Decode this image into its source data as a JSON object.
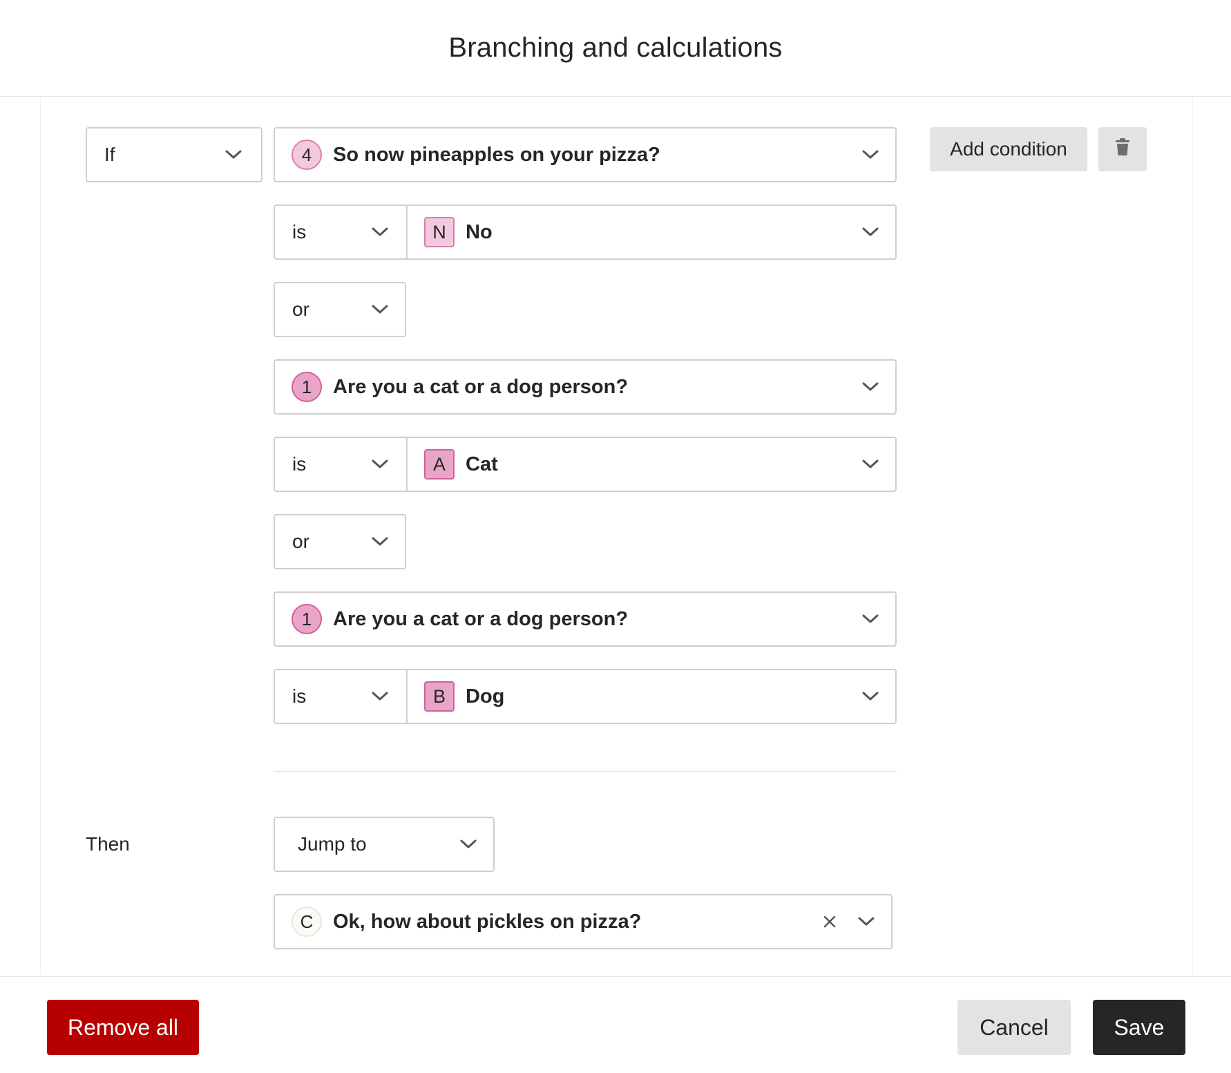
{
  "dialog": {
    "title": "Branching and calculations"
  },
  "logic": {
    "if_label": "If",
    "add_condition": "Add condition",
    "conditions": [
      {
        "question_badge": "4",
        "question": "So now pineapples on your pizza?",
        "operator": "is",
        "answer_badge": "N",
        "answer": "No",
        "joiner": "or"
      },
      {
        "question_badge": "1",
        "question": "Are you a cat or a dog person?",
        "operator": "is",
        "answer_badge": "A",
        "answer": "Cat",
        "joiner": "or"
      },
      {
        "question_badge": "1",
        "question": "Are you a cat or a dog person?",
        "operator": "is",
        "answer_badge": "B",
        "answer": "Dog"
      }
    ],
    "then_label": "Then",
    "action": "Jump to",
    "destination": {
      "badge": "C",
      "label": "Ok, how about pickles on pizza?"
    }
  },
  "footer": {
    "remove_all": "Remove all",
    "cancel": "Cancel",
    "save": "Save"
  },
  "colors": {
    "badge_pink": "#e8a5c8",
    "badge_border": "#d45f9c",
    "remove_red": "#b70000",
    "save_dark": "#262627",
    "gray_button": "#e3e3e3"
  },
  "icons": {
    "dropdown": "chevron-down-icon",
    "delete": "trash-icon",
    "clear": "close-icon"
  }
}
